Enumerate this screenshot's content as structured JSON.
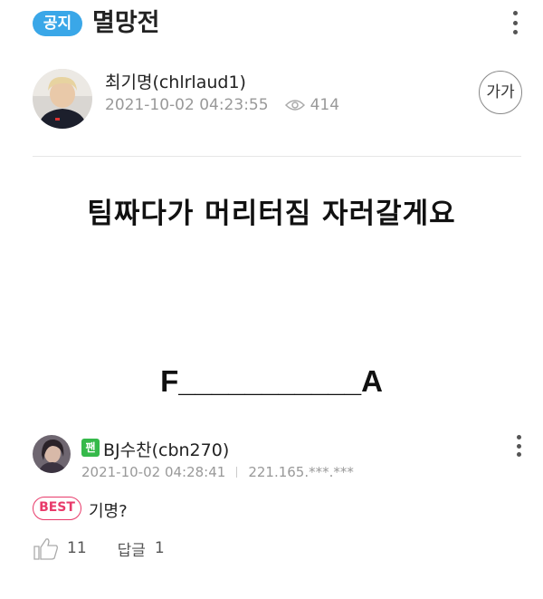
{
  "header": {
    "notice_badge": "공지",
    "title": "멸망전"
  },
  "author": {
    "name": "최기명(chlrlaud1)",
    "datetime": "2021-10-02 04:23:55",
    "views": "414",
    "font_size_button": "가가"
  },
  "post": {
    "line1": "팀짜다가 머리터짐 자러갈게요",
    "line2": "F___________A"
  },
  "comment": {
    "fan_badge": "팬",
    "name": "BJ수찬(cbn270)",
    "datetime": "2021-10-02 04:28:41",
    "ip": "221.165.***.***",
    "best_badge": "BEST",
    "text": "기명?",
    "likes": "11",
    "reply_label": "답글",
    "reply_count": "1"
  },
  "colors": {
    "notice_badge": "#3aa7e8",
    "fan_badge": "#35b94a",
    "best_badge": "#e83a6a"
  }
}
